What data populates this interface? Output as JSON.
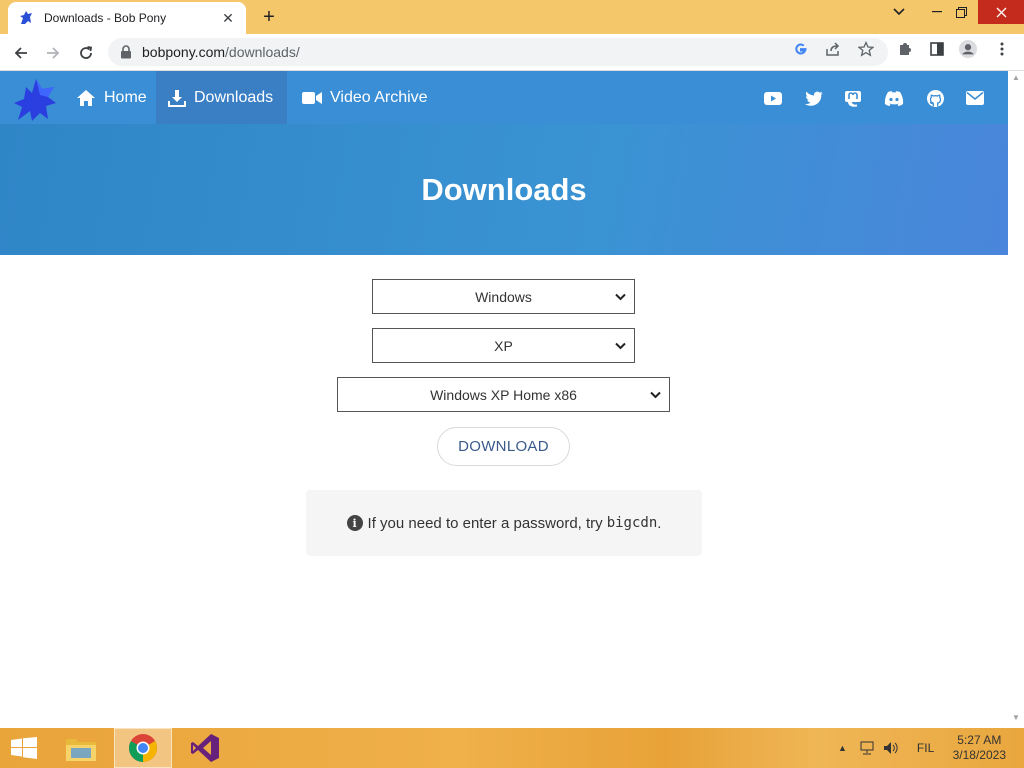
{
  "browser": {
    "tab_title": "Downloads - Bob Pony",
    "url_host": "bobpony.com",
    "url_path": "/downloads/"
  },
  "site": {
    "nav": [
      {
        "label": "Home",
        "icon": "home-icon"
      },
      {
        "label": "Downloads",
        "icon": "download-icon"
      },
      {
        "label": "Video Archive",
        "icon": "video-icon"
      }
    ],
    "social_icons": [
      "youtube-icon",
      "twitter-icon",
      "mastodon-icon",
      "discord-icon",
      "github-icon",
      "mail-icon"
    ],
    "brand_color": "#3a8ed6"
  },
  "page": {
    "title": "Downloads",
    "selects": {
      "os": "Windows",
      "version": "XP",
      "edition": "Windows XP Home x86"
    },
    "download_label": "DOWNLOAD",
    "note_text": "If you need to enter a password, try",
    "note_code": "bigcdn",
    "note_suffix": "."
  },
  "taskbar": {
    "language": "FIL",
    "time": "5:27 AM",
    "date": "3/18/2023"
  }
}
